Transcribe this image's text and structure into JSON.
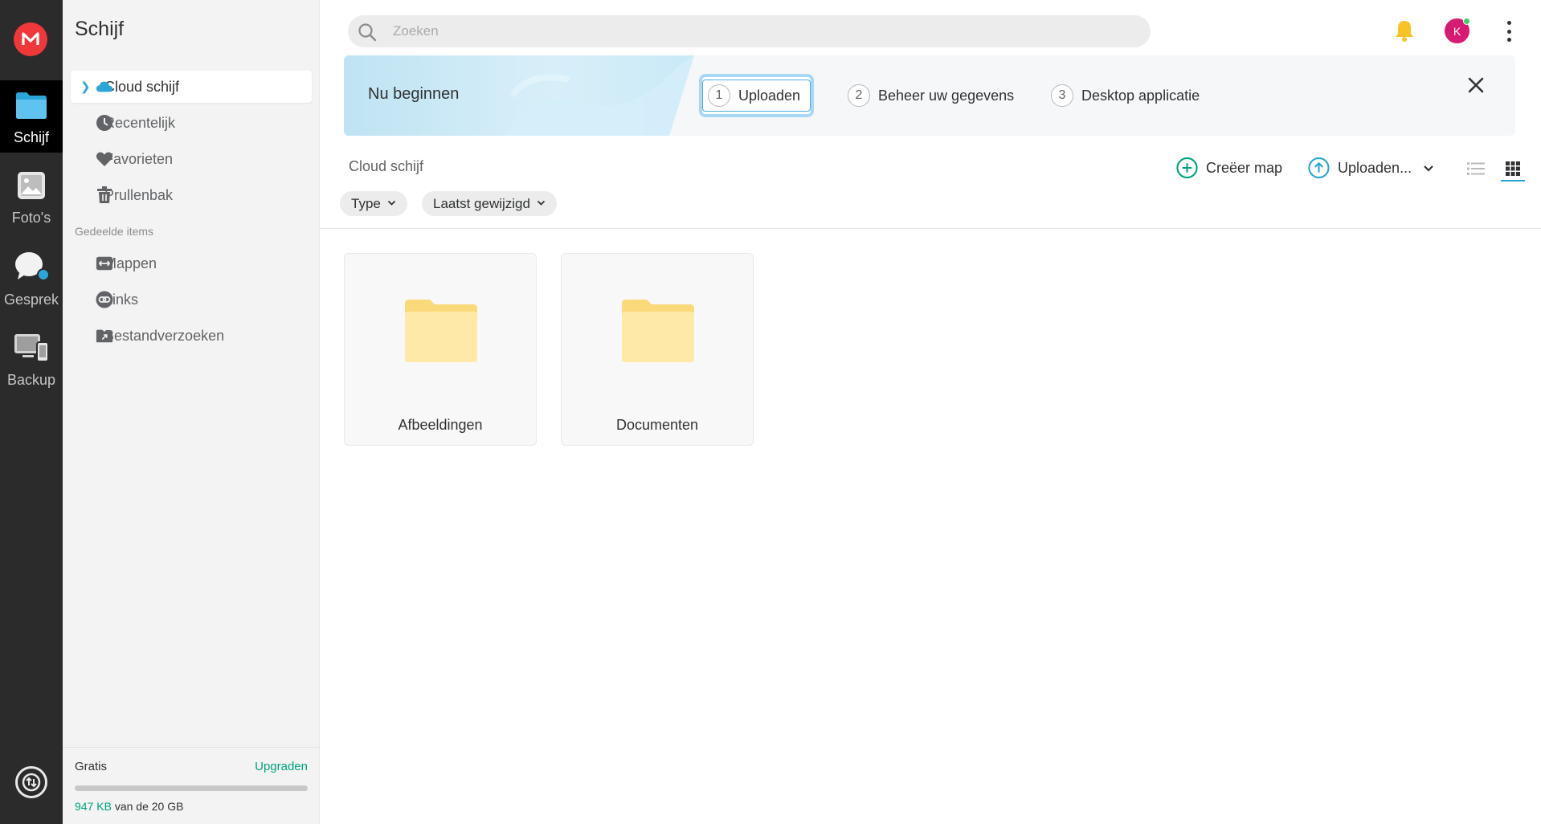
{
  "rail": {
    "items": [
      {
        "label": "Schijf"
      },
      {
        "label": "Foto's"
      },
      {
        "label": "Gesprek"
      },
      {
        "label": "Backup"
      }
    ]
  },
  "sidebar": {
    "title": "Schijf",
    "items": [
      {
        "label": "Cloud schijf"
      },
      {
        "label": "Recentelijk"
      },
      {
        "label": "Favorieten"
      },
      {
        "label": "Prullenbak"
      }
    ],
    "shared_section": "Gedeelde items",
    "shared_items": [
      {
        "label": "Mappen"
      },
      {
        "label": "Links"
      },
      {
        "label": "Bestandverzoeken"
      }
    ],
    "footer": {
      "plan": "Gratis",
      "upgrade": "Upgraden",
      "used": "947 KB",
      "total_text": " van de 20 GB",
      "usage_fraction": 0.0
    }
  },
  "header": {
    "search_placeholder": "Zoeken",
    "avatar_initial": "K"
  },
  "banner": {
    "title": "Nu beginnen",
    "steps": [
      {
        "num": "1",
        "label": "Uploaden"
      },
      {
        "num": "2",
        "label": "Beheer uw gegevens"
      },
      {
        "num": "3",
        "label": "Desktop applicatie"
      }
    ]
  },
  "toolbar": {
    "breadcrumb": "Cloud schijf",
    "create_folder": "Creëer map",
    "upload": "Uploaden..."
  },
  "filters": {
    "type": "Type",
    "modified": "Laatst gewijzigd"
  },
  "folders": [
    {
      "name": "Afbeeldingen"
    },
    {
      "name": "Documenten"
    }
  ],
  "colors": {
    "accent_green": "#00a382",
    "accent_blue": "#2aa7d8",
    "brand_red": "#f0373a",
    "avatar_pink": "#d81b72",
    "folder_yellow": "#ffe9a8"
  }
}
